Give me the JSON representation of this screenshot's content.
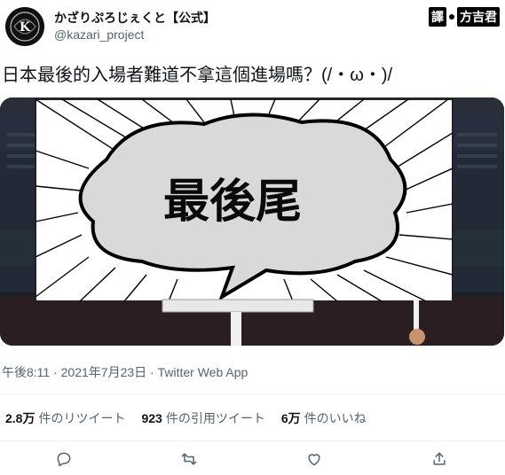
{
  "header": {
    "display_name": "かざりぷろじぇくと【公式】",
    "handle": "@kazari_project",
    "avatar_letter": "K",
    "avatar_icon": "crest-logo-icon"
  },
  "translator_tag": {
    "badge": "譯",
    "name": "方吉君"
  },
  "tweet": {
    "text": "日本最後的入場者難道不拿這個進場嗎？(/・ω・)/"
  },
  "media": {
    "sign_text": "最後尾"
  },
  "meta": {
    "timestamp": "午後8:11 · 2021年7月23日 · Twitter Web App"
  },
  "stats": {
    "retweets_count": "2.8万",
    "retweets_label": "件のリツイート",
    "quotes_count": "923",
    "quotes_label": "件の引用ツイート",
    "likes_count": "6万",
    "likes_label": "件のいいね"
  },
  "actions": [
    {
      "name": "reply-button",
      "icon": "reply-icon"
    },
    {
      "name": "retweet-button",
      "icon": "retweet-icon"
    },
    {
      "name": "like-button",
      "icon": "heart-icon"
    },
    {
      "name": "share-button",
      "icon": "share-icon"
    }
  ]
}
